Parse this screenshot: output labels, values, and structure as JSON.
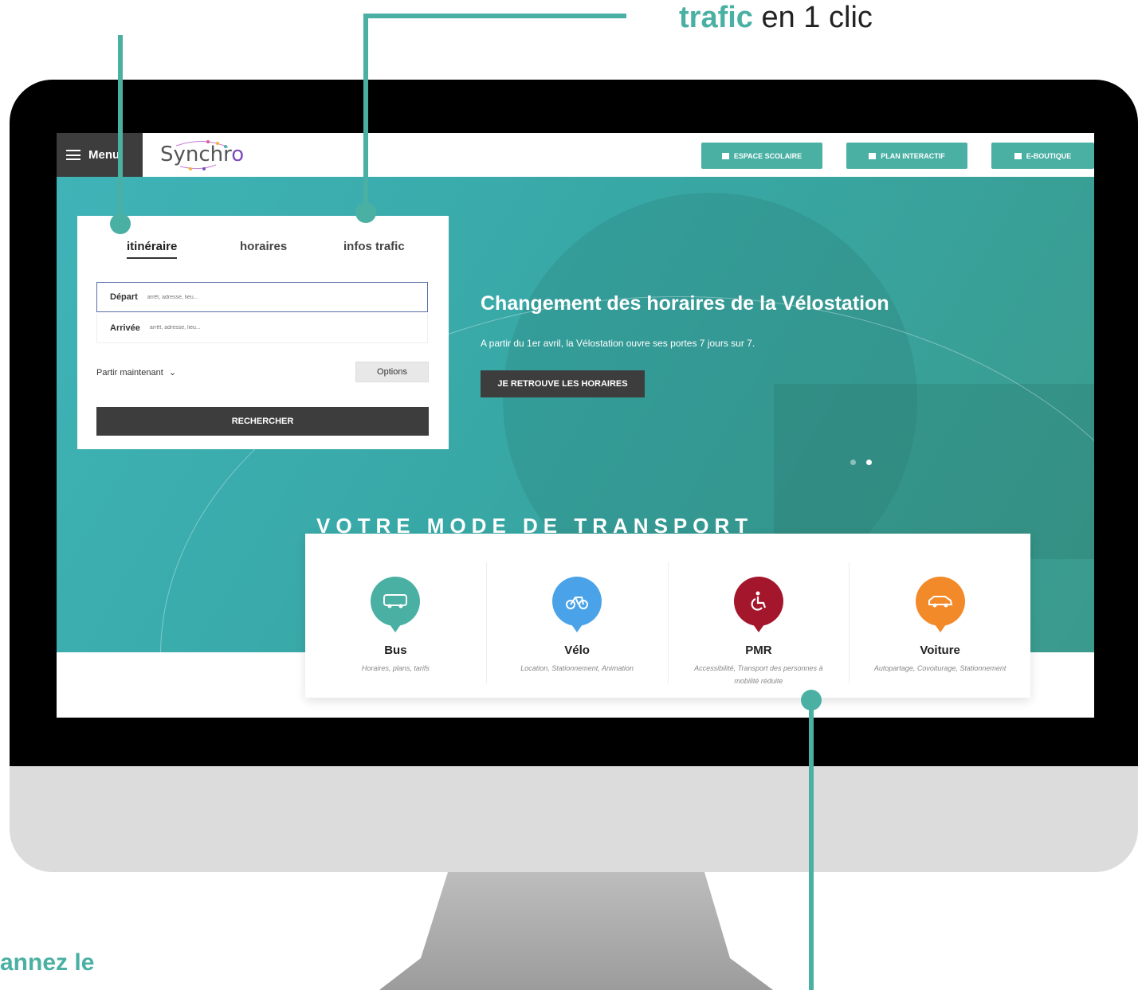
{
  "callouts": {
    "top_accent": "trafic",
    "top_rest": " en 1 clic",
    "bottom": "annez le"
  },
  "header": {
    "menu_label": "Menu",
    "logo_prefix": "Synchr",
    "logo_o": "o",
    "buttons": [
      {
        "label": "ESPACE SCOLAIRE",
        "icon": "briefcase-icon"
      },
      {
        "label": "PLAN INTERACTIF",
        "icon": "map-icon"
      },
      {
        "label": "E-BOUTIQUE",
        "icon": "cart-icon"
      }
    ]
  },
  "search": {
    "tabs": [
      "itinéraire",
      "horaires",
      "infos trafic"
    ],
    "active_tab": "itinéraire",
    "depart": {
      "label": "Départ",
      "placeholder": "arrêt, adresse, lieu..."
    },
    "arrivee": {
      "label": "Arrivée",
      "placeholder": "arrêt, adresse, lieu..."
    },
    "when": "Partir maintenant",
    "options": "Options",
    "submit": "RECHERCHER"
  },
  "hero": {
    "title": "Changement des horaires de la Vélostation",
    "subtitle": "A partir du 1er avril, la Vélostation ouvre ses portes 7 jours sur 7.",
    "cta": "JE RETROUVE LES HORAIRES"
  },
  "transport": {
    "title": "VOTRE MODE DE TRANSPORT",
    "modes": [
      {
        "name": "Bus",
        "desc": "Horaires, plans, tarifs",
        "color": "#4ab0a3",
        "icon": "bus-icon"
      },
      {
        "name": "Vélo",
        "desc": "Location, Stationnement, Animation",
        "color": "#4aa3e8",
        "icon": "bike-icon"
      },
      {
        "name": "PMR",
        "desc": "Accessibilité, Transport des personnes à mobilité réduite",
        "color": "#a4162b",
        "icon": "wheelchair-icon"
      },
      {
        "name": "Voiture",
        "desc": "Autopartage, Covoiturage, Stationnement",
        "color": "#f38a2a",
        "icon": "car-icon"
      }
    ]
  },
  "colors": {
    "accent": "#4ab0a3",
    "dark": "#3d3d3d"
  }
}
